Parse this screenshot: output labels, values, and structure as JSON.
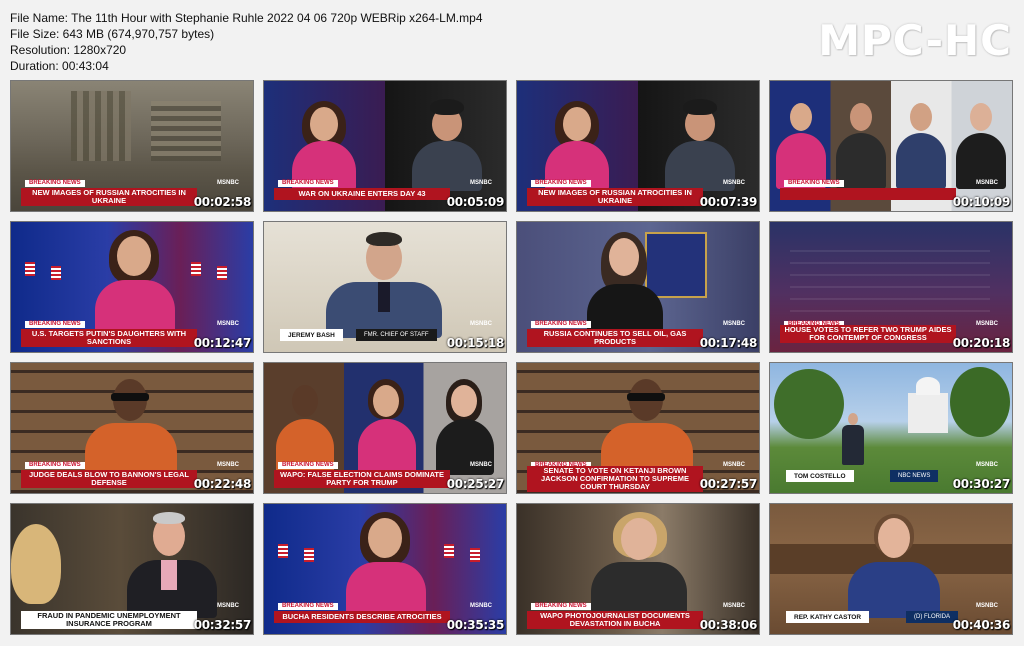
{
  "file_info": {
    "file_name": "File Name: The 11th Hour with Stephanie Ruhle 2022 04 06 720p WEBRip x264-LM.mp4",
    "file_size": "File Size: 643 MB (674,970,757 bytes)",
    "resolution": "Resolution: 1280x720",
    "duration": "Duration: 00:43:04"
  },
  "brand": "MPC-HC",
  "network": "MSNBC",
  "breaking_label": "BREAKING NEWS",
  "thumbnails": [
    {
      "timestamp": "00:02:58",
      "chyron": "NEW IMAGES OF RUSSIAN ATROCITIES IN UKRAINE"
    },
    {
      "timestamp": "00:05:09",
      "chyron": "WAR ON UKRAINE ENTERS DAY 43"
    },
    {
      "timestamp": "00:07:39",
      "chyron": "NEW IMAGES OF RUSSIAN ATROCITIES IN UKRAINE"
    },
    {
      "timestamp": "00:10:09",
      "chyron": ""
    },
    {
      "timestamp": "00:12:47",
      "chyron": "U.S. TARGETS PUTIN'S DAUGHTERS WITH SANCTIONS"
    },
    {
      "timestamp": "00:15:18",
      "name": "JEREMY BASH",
      "title": "FMR. CHIEF OF STAFF"
    },
    {
      "timestamp": "00:17:48",
      "chyron": "RUSSIA CONTINUES TO SELL OIL, GAS PRODUCTS"
    },
    {
      "timestamp": "00:20:18",
      "chyron": "HOUSE VOTES TO REFER TWO TRUMP AIDES FOR CONTEMPT OF CONGRESS"
    },
    {
      "timestamp": "00:22:48",
      "chyron": "JUDGE DEALS BLOW TO BANNON'S LEGAL DEFENSE"
    },
    {
      "timestamp": "00:25:27",
      "chyron": "WAPO: FALSE ELECTION CLAIMS DOMINATE PARTY FOR TRUMP"
    },
    {
      "timestamp": "00:27:57",
      "chyron": "SENATE TO VOTE ON KETANJI BROWN JACKSON CONFIRMATION TO SUPREME COURT THURSDAY"
    },
    {
      "timestamp": "00:30:27",
      "name": "TOM COSTELLO",
      "title": "NBC NEWS"
    },
    {
      "timestamp": "00:32:57",
      "chyron": "FRAUD IN PANDEMIC UNEMPLOYMENT INSURANCE PROGRAM"
    },
    {
      "timestamp": "00:35:35",
      "chyron": "BUCHA RESIDENTS DESCRIBE ATROCITIES"
    },
    {
      "timestamp": "00:38:06",
      "chyron": "WAPO PHOTOJOURNALIST DOCUMENTS DEVASTATION IN BUCHA"
    },
    {
      "timestamp": "00:40:36",
      "name": "REP. KATHY CASTOR",
      "title": "(D) FLORIDA"
    }
  ]
}
